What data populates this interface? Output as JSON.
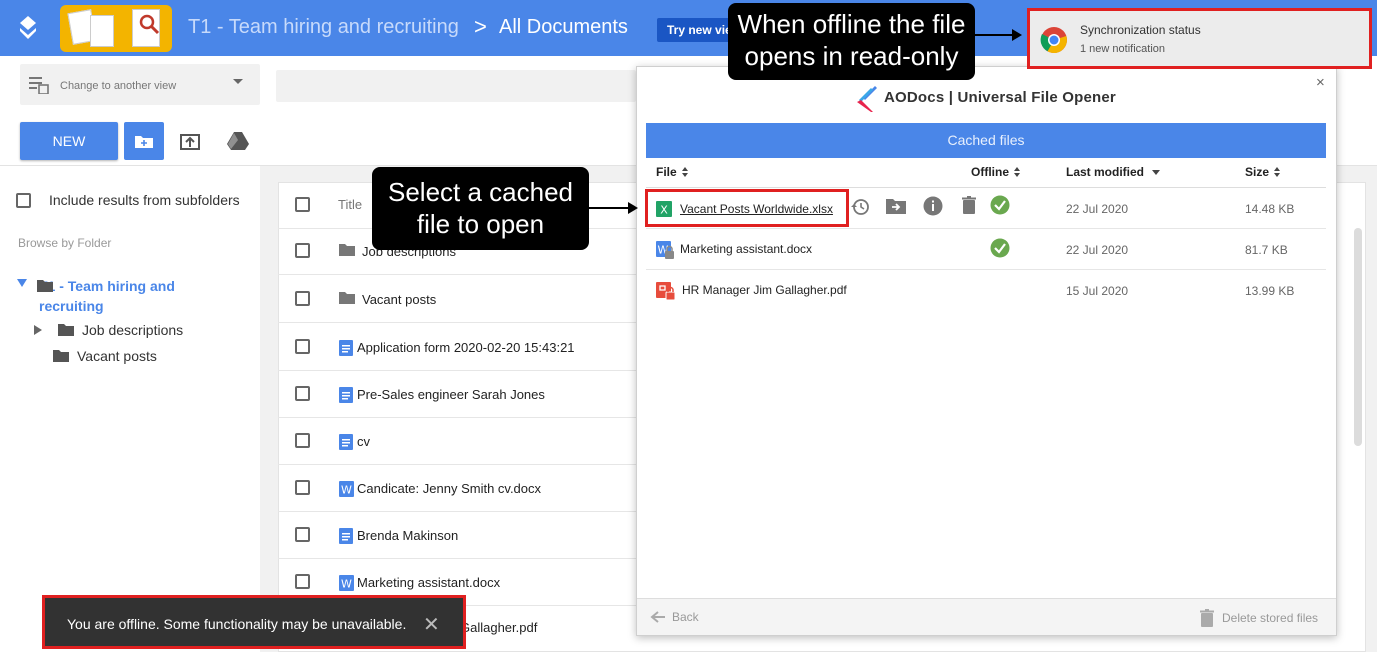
{
  "header": {
    "library": "T1 - Team hiring and recruiting",
    "separator": ">",
    "current": "All Documents",
    "try_button": "Try new view"
  },
  "viewbar": {
    "view_select_label": "Change to another view"
  },
  "toolbar": {
    "new_label": "NEW"
  },
  "sidebar": {
    "include_subfolders": "Include results from subfolders",
    "browse_label": "Browse by Folder",
    "tree": {
      "root": "T1 - Team hiring and recruiting",
      "children": [
        "Job descriptions",
        "Vacant posts"
      ]
    }
  },
  "doclist": {
    "title_header": "Title",
    "rows": [
      {
        "name": "Job descriptions",
        "type": "folder"
      },
      {
        "name": "Vacant posts",
        "type": "folder"
      },
      {
        "name": "Application form 2020-02-20 15:43:21",
        "type": "gdoc"
      },
      {
        "name": "Pre-Sales engineer Sarah Jones",
        "type": "gdoc"
      },
      {
        "name": "cv",
        "type": "gdoc"
      },
      {
        "name": "Candicate: Jenny Smith cv.docx",
        "type": "word"
      },
      {
        "name": "Brenda Makinson",
        "type": "gdoc"
      },
      {
        "name": "Marketing assistant.docx",
        "type": "word"
      },
      {
        "name": "Gallagher.pdf",
        "type": "pdf"
      }
    ]
  },
  "dialog": {
    "title": "AODocs | Universal File Opener",
    "close": "×",
    "section": "Cached files",
    "columns": {
      "file": "File",
      "offline": "Offline",
      "last_modified": "Last modified",
      "size": "Size"
    },
    "files": [
      {
        "name": "Vacant Posts Worldwide.xlsx",
        "type": "xlsx",
        "offline": true,
        "date": "22 Jul 2020",
        "size": "14.48 KB"
      },
      {
        "name": "Marketing assistant.docx",
        "type": "docx",
        "offline": true,
        "date": "22 Jul 2020",
        "size": "81.7 KB"
      },
      {
        "name": "HR Manager Jim Gallagher.pdf",
        "type": "pdf",
        "offline": false,
        "date": "15 Jul 2020",
        "size": "13.99 KB"
      }
    ],
    "back": "Back",
    "delete_stored": "Delete stored files"
  },
  "notification": {
    "title": "Synchronization status",
    "subtitle": "1 new notification"
  },
  "callouts": {
    "offline_line1": "When offline the file",
    "offline_line2": "opens in read-only",
    "select_line1": "Select a cached",
    "select_line2": "file to open"
  },
  "toast": {
    "message": "You are offline. Some functionality may be unavailable.",
    "close": "✕"
  },
  "colors": {
    "brand_blue": "#4a86e8",
    "highlight_red": "#e02020",
    "offline_green": "#6aa84f",
    "excel_green": "#21a366",
    "pdf_red": "#e74c3c"
  }
}
